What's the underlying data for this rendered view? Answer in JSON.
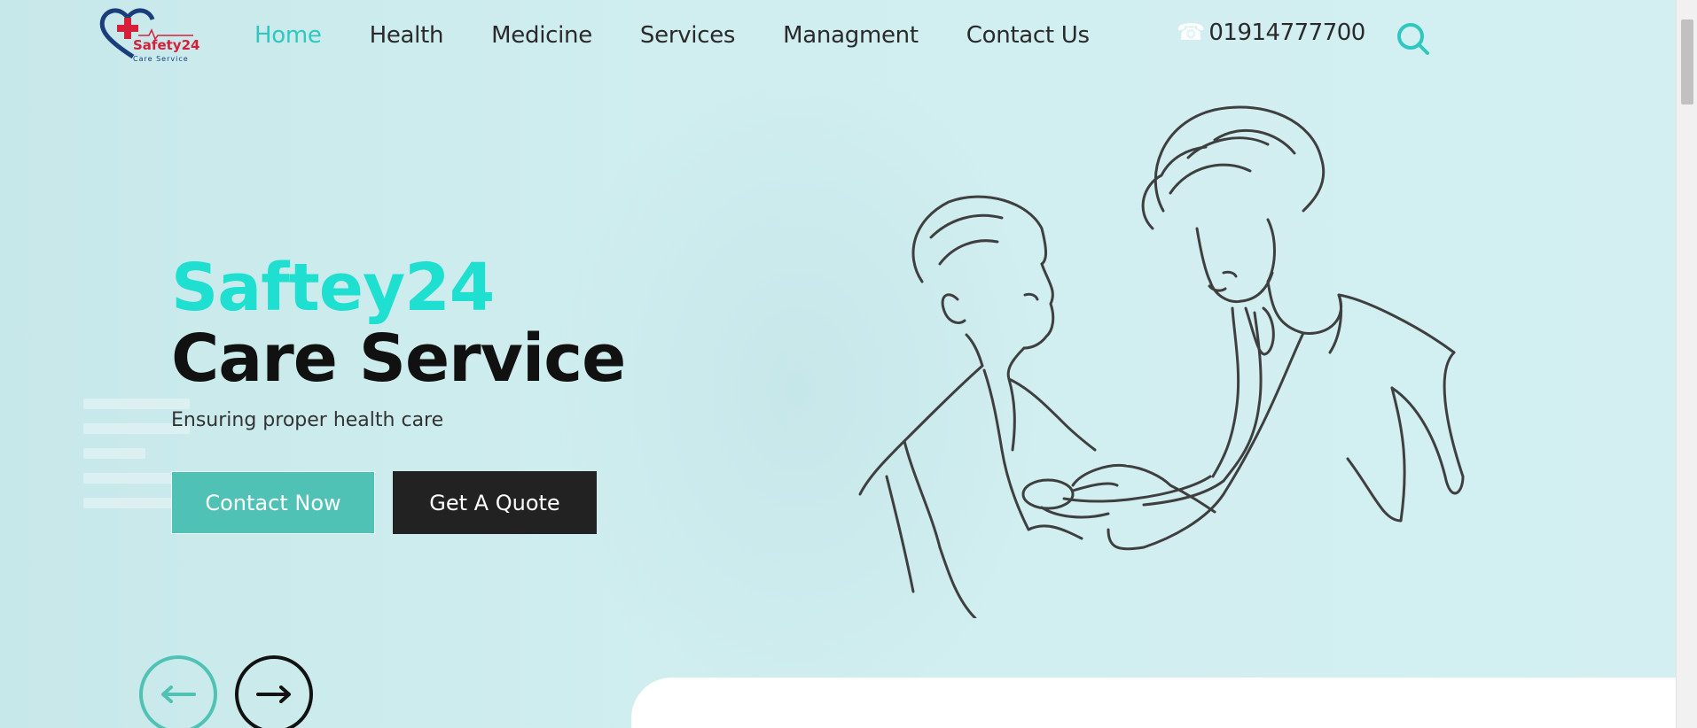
{
  "brand": {
    "logo_text": "Safety24",
    "logo_subtitle": "Care Service",
    "colors": {
      "accent": "#2ec8c0",
      "title_accent": "#1fe0d0",
      "button_primary": "#4fc2b5",
      "button_dark": "#222222",
      "logo_red": "#d6203a",
      "logo_blue": "#1a3d7c"
    }
  },
  "nav": {
    "items": [
      {
        "label": "Home",
        "active": true
      },
      {
        "label": "Health"
      },
      {
        "label": "Medicine"
      },
      {
        "label": "Services"
      },
      {
        "label": "Managment"
      },
      {
        "label": "Contact Us"
      }
    ],
    "phone": {
      "icon": "phone-icon",
      "number": "01914777700"
    },
    "search_icon": "search-icon"
  },
  "hero": {
    "title_line1": "Saftey24",
    "title_line2": "Care Service",
    "subtitle": "Ensuring proper health care",
    "primary_button": "Contact Now",
    "secondary_button": "Get A Quote",
    "prev_icon": "arrow-left-icon",
    "next_icon": "arrow-right-icon"
  }
}
